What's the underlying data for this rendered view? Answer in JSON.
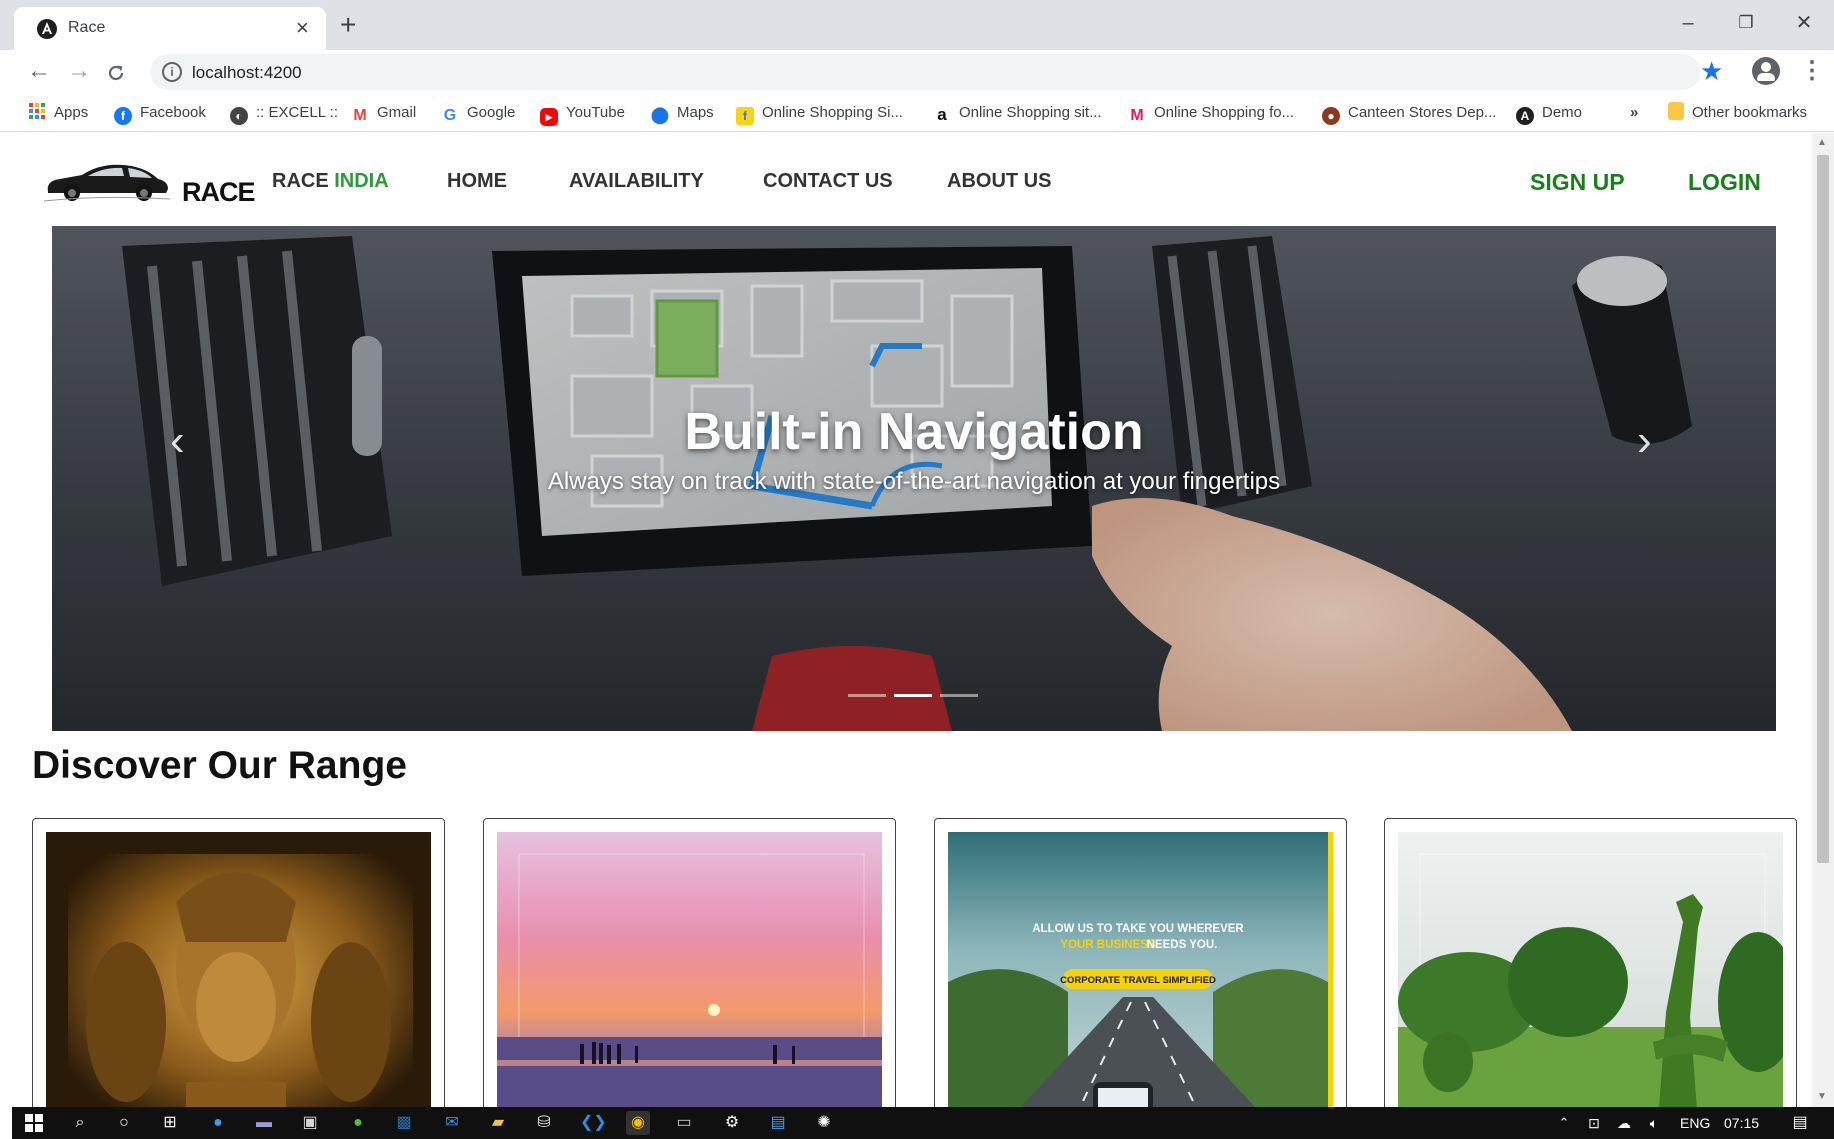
{
  "browser": {
    "tab_title": "Race",
    "tab_close": "×",
    "new_tab": "+",
    "url": "localhost:4200",
    "window_controls": {
      "minimize": "–",
      "restore": "❐",
      "close": "✕"
    },
    "nav": {
      "back": "←",
      "forward": "→",
      "reload": "C"
    },
    "bookmarks": [
      {
        "label": "Apps",
        "icon": "apps-grid-icon"
      },
      {
        "label": "Facebook",
        "icon": "facebook-icon"
      },
      {
        "label": ":: EXCELL ::",
        "icon": "globe-icon"
      },
      {
        "label": "Gmail",
        "icon": "gmail-icon"
      },
      {
        "label": "Google",
        "icon": "google-icon"
      },
      {
        "label": "YouTube",
        "icon": "youtube-icon"
      },
      {
        "label": "Maps",
        "icon": "maps-pin-icon"
      },
      {
        "label": "Online Shopping Si...",
        "icon": "flipkart-icon"
      },
      {
        "label": "Online Shopping sit...",
        "icon": "amazon-icon"
      },
      {
        "label": "Online Shopping fo...",
        "icon": "myntra-icon"
      },
      {
        "label": "Canteen Stores Dep...",
        "icon": "canteen-icon"
      },
      {
        "label": "Demo",
        "icon": "angular-icon"
      }
    ],
    "bookmarks_overflow": "»",
    "other_bookmarks": "Other bookmarks"
  },
  "page": {
    "logo_text": "RACE",
    "brand": {
      "part1": "RACE",
      "part2": "INDIA"
    },
    "nav_links": [
      "HOME",
      "AVAILABILITY",
      "CONTACT US",
      "ABOUT US"
    ],
    "auth": {
      "signup": "SIGN UP",
      "login": "LOGIN"
    },
    "carousel": {
      "title": "Built-in Navigation",
      "text": "Always stay on track with state-of-the-art navigation at your fingertips",
      "prev": "‹",
      "next": "›",
      "slide_count": 3,
      "active_slide": 2
    },
    "section_title": "Discover Our Range",
    "cards": [
      {
        "name": "elephanta-caves"
      },
      {
        "name": "beach-sunset"
      },
      {
        "name": "corporate-travel",
        "headline_1": "ALLOW US TO TAKE YOU WHEREVER",
        "headline_highlight": "YOUR BUSINESS",
        "headline_2": "NEEDS YOU.",
        "badge": "CORPORATE TRAVEL SIMPLIFIED"
      },
      {
        "name": "topiary-garden"
      }
    ]
  },
  "taskbar": {
    "language": "ENG",
    "time": "07:15"
  },
  "colors": {
    "accent_green": "#2e9b3a",
    "auth_green": "#1a7f1a",
    "bookmark_star": "#1a73e8"
  }
}
